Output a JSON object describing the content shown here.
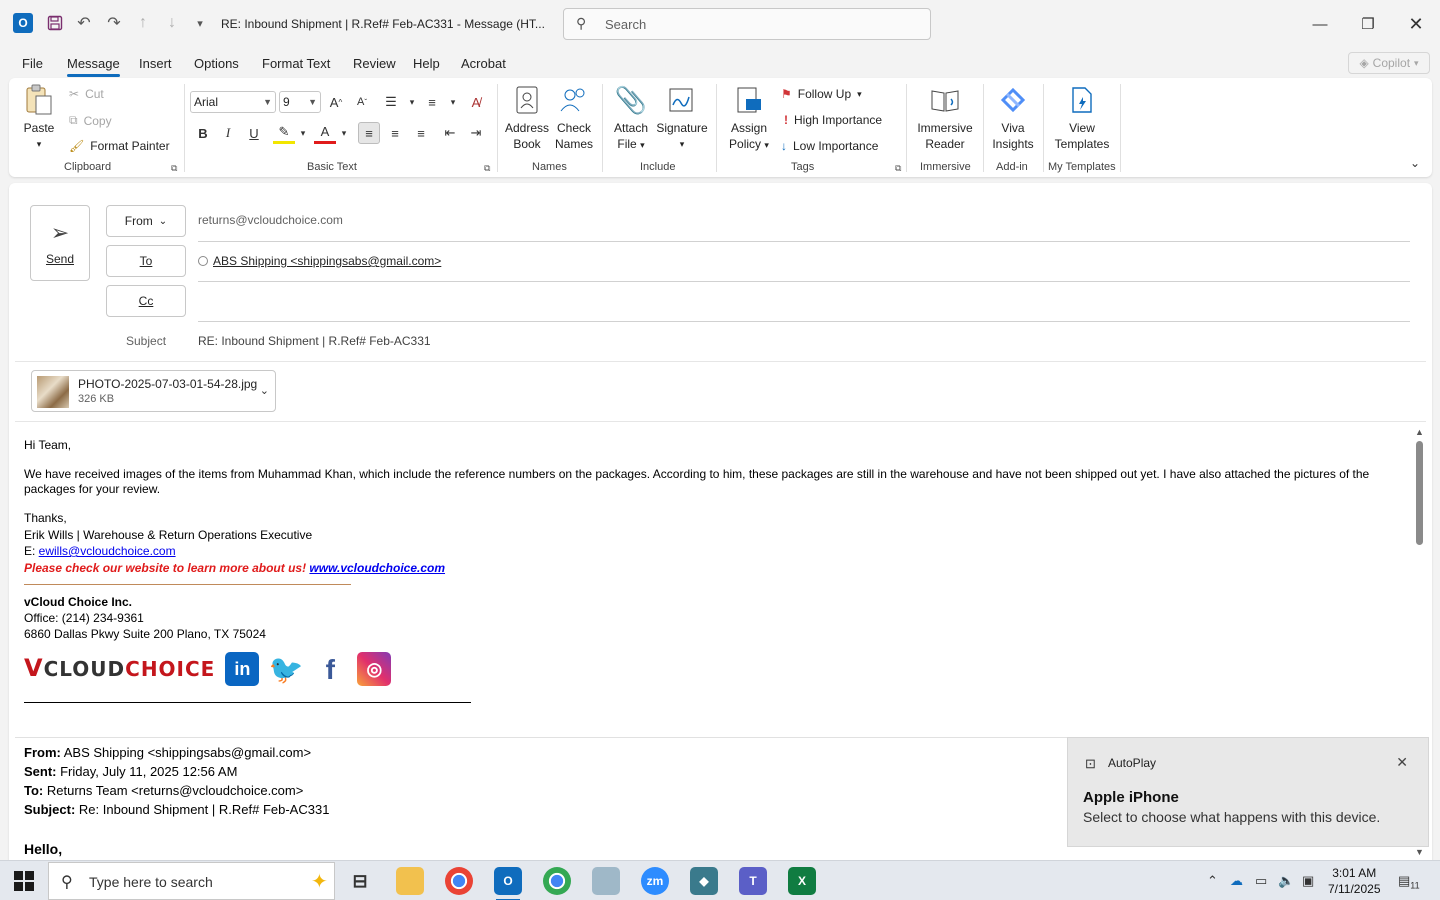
{
  "window": {
    "title": "RE: Inbound Shipment | R.Ref# Feb-AC331  -  Message (HT...",
    "search_placeholder": "Search",
    "app_logo": "O"
  },
  "menu_tabs": [
    "File",
    "Message",
    "Insert",
    "Options",
    "Format Text",
    "Review",
    "Help",
    "Acrobat"
  ],
  "copilot_label": "Copilot",
  "ribbon": {
    "clipboard": {
      "paste": "Paste",
      "cut": "Cut",
      "copy": "Copy",
      "format_painter": "Format Painter",
      "label": "Clipboard"
    },
    "basic_text": {
      "font": "Arial",
      "size": "9",
      "label": "Basic Text"
    },
    "names": {
      "address_book_1": "Address",
      "address_book_2": "Book",
      "check_names_1": "Check",
      "check_names_2": "Names",
      "label": "Names"
    },
    "include": {
      "attach_1": "Attach",
      "attach_2": "File",
      "signature": "Signature",
      "label": "Include"
    },
    "tags": {
      "assign_1": "Assign",
      "assign_2": "Policy",
      "follow_up": "Follow Up",
      "high": "High Importance",
      "low": "Low Importance",
      "label": "Tags"
    },
    "immersive": {
      "reader_1": "Immersive",
      "reader_2": "Reader",
      "label": "Immersive"
    },
    "addin": {
      "viva_1": "Viva",
      "viva_2": "Insights",
      "label": "Add-in"
    },
    "templates": {
      "view_1": "View",
      "view_2": "Templates",
      "label": "My Templates"
    }
  },
  "compose": {
    "send_label": "Send",
    "from_label": "From",
    "from_value": "returns@vcloudchoice.com",
    "to_label": "To",
    "to_value": "ABS Shipping <shippingsabs@gmail.com>",
    "cc_label": "Cc",
    "subject_label": "Subject",
    "subject_value": "RE: Inbound Shipment | R.Ref# Feb-AC331",
    "attachment": {
      "name": "PHOTO-2025-07-03-01-54-28.jpg",
      "size": "326 KB"
    }
  },
  "body": {
    "greeting": "Hi Team,",
    "paragraph": "We have received images of the items from Muhammad Khan, which include the reference numbers on the packages. According to him, these packages are still in the warehouse and have not been shipped out yet. I have also attached the pictures of the packages for your review.",
    "thanks": "Thanks,",
    "signature_name": "Erik Wills | Warehouse & Return Operations Executive",
    "email_prefix": "E: ",
    "email": "ewills@vcloudchoice.com",
    "promo_text": "Please check our website to learn more about us! ",
    "website": "www.vcloudchoice.com",
    "company": "vCloud Choice Inc.",
    "office": "Office: (214) 234-9361",
    "address": "6860 Dallas Pkwy Suite 200 Plano, TX 75024",
    "logo_text_v": "V",
    "logo_text_cloud": "CLOUD",
    "logo_text_choice": "CHOICE"
  },
  "quoted": {
    "from_label": "From:",
    "from_value": " ABS Shipping <shippingsabs@gmail.com>",
    "sent_label": "Sent:",
    "sent_value": " Friday, July 11, 2025 12:56 AM",
    "to_label": "To:",
    "to_value": " Returns Team <returns@vcloudchoice.com>",
    "subject_label": "Subject:",
    "subject_value": " Re: Inbound Shipment | R.Ref# Feb-AC331",
    "hello": "Hello,"
  },
  "toast": {
    "app": "AutoPlay",
    "title": "Apple iPhone",
    "message": "Select to choose what happens with this device."
  },
  "taskbar": {
    "search_placeholder": "Type here to search",
    "time": "3:01 AM",
    "date": "7/11/2025",
    "notifications": "11"
  }
}
